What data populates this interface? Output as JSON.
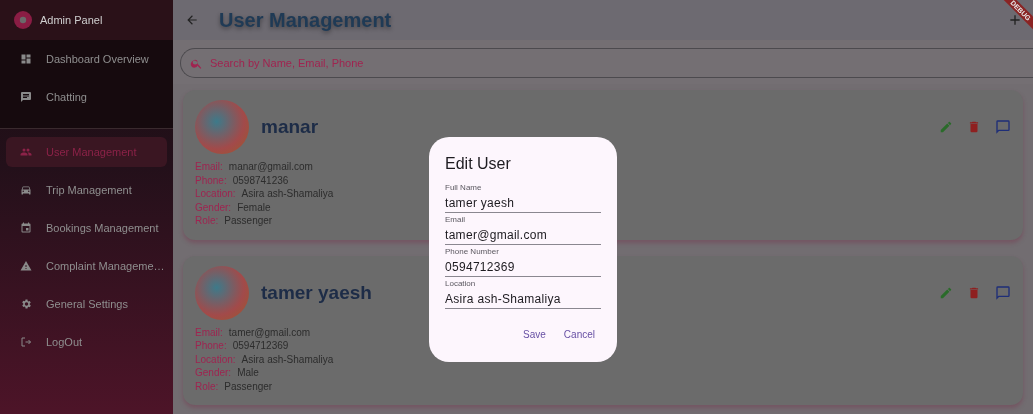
{
  "sidebar": {
    "title": "Admin Panel",
    "items": [
      {
        "label": "Dashboard Overview",
        "selected": false
      },
      {
        "label": "Chatting",
        "selected": false
      },
      {
        "label": "User Management",
        "selected": true
      },
      {
        "label": "Trip Management",
        "selected": false
      },
      {
        "label": "Bookings Management",
        "selected": false
      },
      {
        "label": "Complaint Manageme…",
        "selected": false
      },
      {
        "label": "General Settings",
        "selected": false
      },
      {
        "label": "LogOut",
        "selected": false
      }
    ]
  },
  "app_bar": {
    "title": "User Management"
  },
  "search": {
    "placeholder": "Search by Name, Email, Phone"
  },
  "users": [
    {
      "name": "manar",
      "fields": [
        {
          "label": "Email:",
          "value": "manar@gmail.com"
        },
        {
          "label": "Phone:",
          "value": "0598741236"
        },
        {
          "label": "Location:",
          "value": "Asira ash-Shamaliya"
        },
        {
          "label": "Gender:",
          "value": "Female"
        },
        {
          "label": "Role:",
          "value": "Passenger"
        }
      ]
    },
    {
      "name": "tamer yaesh",
      "fields": [
        {
          "label": "Email:",
          "value": "tamer@gmail.com"
        },
        {
          "label": "Phone:",
          "value": "0594712369"
        },
        {
          "label": "Location:",
          "value": "Asira ash-Shamaliya"
        },
        {
          "label": "Gender:",
          "value": "Male"
        },
        {
          "label": "Role:",
          "value": "Passenger"
        }
      ]
    }
  ],
  "dialog": {
    "title": "Edit User",
    "fields": [
      {
        "label": "Full Name",
        "value": "tamer yaesh"
      },
      {
        "label": "Email",
        "value": "tamer@gmail.com"
      },
      {
        "label": "Phone Number",
        "value": "0594712369"
      },
      {
        "label": "Location",
        "value": "Asira ash-Shamaliya"
      }
    ],
    "buttons": [
      "Save",
      "Cancel"
    ]
  },
  "debug_banner": "DEBUG"
}
